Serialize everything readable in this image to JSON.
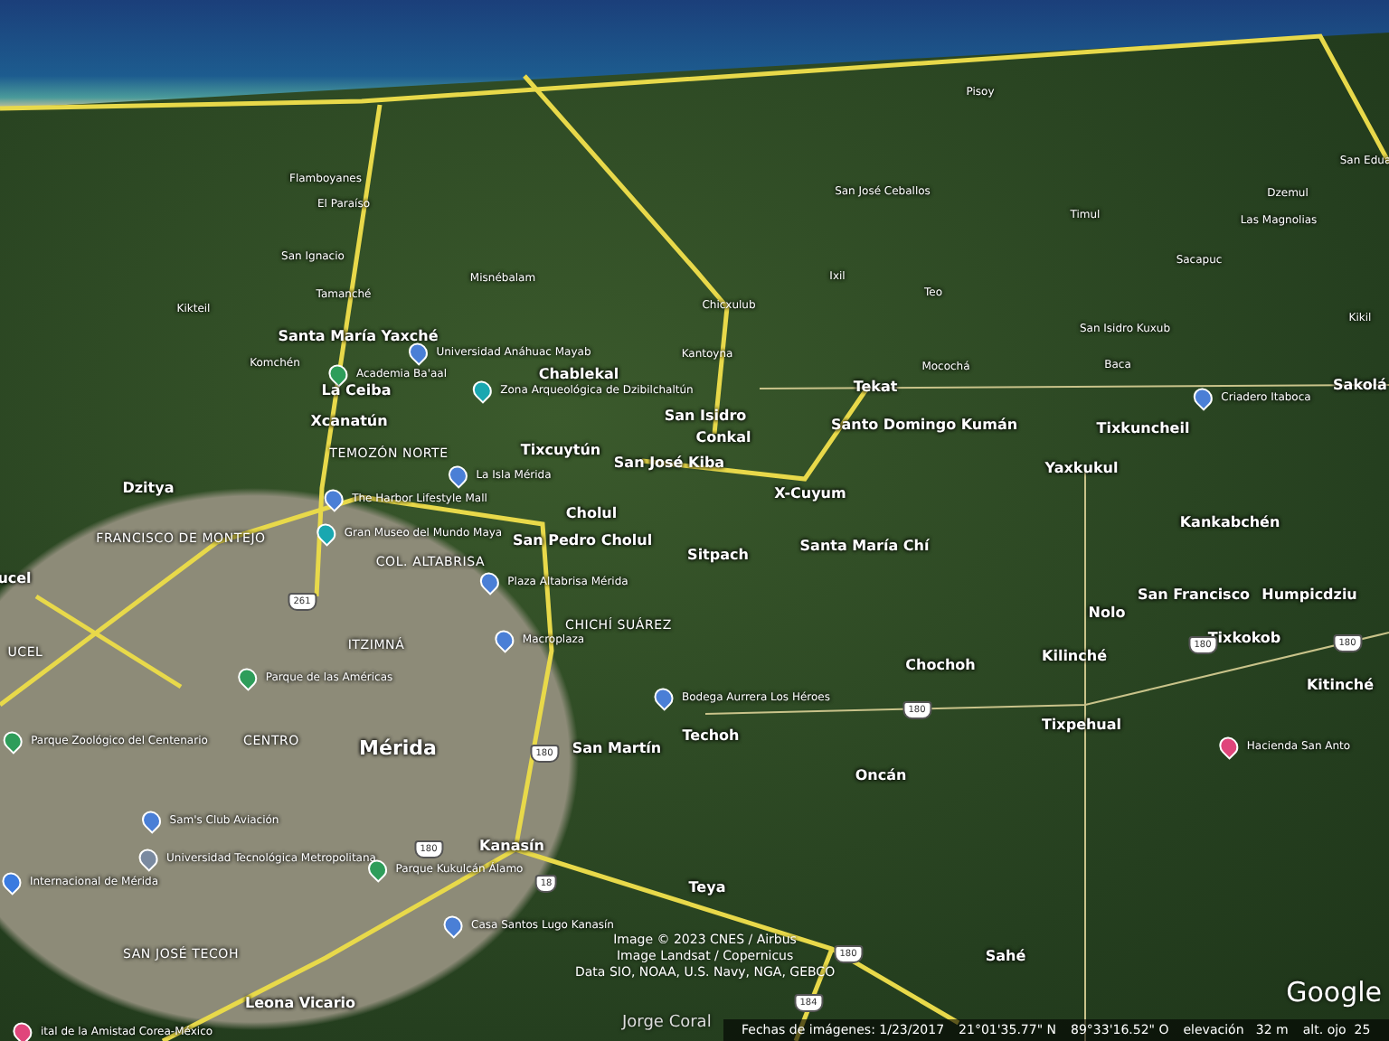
{
  "map": {
    "labels": [
      {
        "text": "Pisoy",
        "kind": "small"
      },
      {
        "text": "San Edua",
        "kind": "small"
      },
      {
        "text": "Flamboyanes",
        "kind": "small"
      },
      {
        "text": "San José Ceballos",
        "kind": "small"
      },
      {
        "text": "Dzemul",
        "kind": "small"
      },
      {
        "text": "El Paraíso",
        "kind": "small"
      },
      {
        "text": "Timul",
        "kind": "small"
      },
      {
        "text": "Las Magnolias",
        "kind": "small"
      },
      {
        "text": "San Ignacio",
        "kind": "small"
      },
      {
        "text": "Sacapuc",
        "kind": "small"
      },
      {
        "text": "Ixil",
        "kind": "small"
      },
      {
        "text": "Misnébalam",
        "kind": "small"
      },
      {
        "text": "Teo",
        "kind": "small"
      },
      {
        "text": "Tamanché",
        "kind": "small"
      },
      {
        "text": "Chicxulub",
        "kind": "small"
      },
      {
        "text": "Kikteil",
        "kind": "small"
      },
      {
        "text": "Kikil",
        "kind": "small"
      },
      {
        "text": "San Isidro Kuxub",
        "kind": "small"
      },
      {
        "text": "Santa María Yaxché",
        "kind": "place"
      },
      {
        "text": "Universidad Anáhuac Mayab",
        "kind": "poi",
        "color": "#4a7fd6"
      },
      {
        "text": "Kantoyna",
        "kind": "small"
      },
      {
        "text": "Komchén",
        "kind": "small"
      },
      {
        "text": "Mocochá",
        "kind": "small"
      },
      {
        "text": "Baca",
        "kind": "small"
      },
      {
        "text": "Academia Ba'aal",
        "kind": "poi",
        "color": "#2e9d5a"
      },
      {
        "text": "Chablekal",
        "kind": "place"
      },
      {
        "text": "Zona Arqueológica de Dzibilchaltún",
        "kind": "poi",
        "color": "#19a7b0"
      },
      {
        "text": "Tekat",
        "kind": "place"
      },
      {
        "text": "Sakolá",
        "kind": "place"
      },
      {
        "text": "Criadero Itaboca",
        "kind": "poi",
        "color": "#4a7fd6"
      },
      {
        "text": "La Ceiba",
        "kind": "place"
      },
      {
        "text": "San Isidro",
        "kind": "place"
      },
      {
        "text": "Xcanatún",
        "kind": "place"
      },
      {
        "text": "Santo Domingo Kumán",
        "kind": "place"
      },
      {
        "text": "Tixkuncheil",
        "kind": "place"
      },
      {
        "text": "Conkal",
        "kind": "place"
      },
      {
        "text": "Tixcuytún",
        "kind": "place"
      },
      {
        "text": "TEMOZÓN NORTE",
        "kind": "district"
      },
      {
        "text": "San José Kiba",
        "kind": "place"
      },
      {
        "text": "Yaxkukul",
        "kind": "place"
      },
      {
        "text": "La Isla Mérida",
        "kind": "poi",
        "color": "#4a7fd6"
      },
      {
        "text": "Dzitya",
        "kind": "place"
      },
      {
        "text": "The Harbor Lifestyle Mall",
        "kind": "poi",
        "color": "#4a7fd6"
      },
      {
        "text": "X-Cuyum",
        "kind": "place"
      },
      {
        "text": "Cholul",
        "kind": "place"
      },
      {
        "text": "Kankabchén",
        "kind": "place"
      },
      {
        "text": "FRANCISCO DE MONTEJO",
        "kind": "district"
      },
      {
        "text": "Gran Museo del Mundo Maya",
        "kind": "poi",
        "color": "#19a7b0"
      },
      {
        "text": "San Pedro Cholul",
        "kind": "place"
      },
      {
        "text": "Santa María Chí",
        "kind": "place"
      },
      {
        "text": "Sitpach",
        "kind": "place"
      },
      {
        "text": "COL. ALTABRISA",
        "kind": "district"
      },
      {
        "text": "ucel",
        "kind": "place"
      },
      {
        "text": "Plaza Altabrisa Mérida",
        "kind": "poi",
        "color": "#4a7fd6"
      },
      {
        "text": "261",
        "kind": "shield"
      },
      {
        "text": "San Francisco",
        "kind": "place"
      },
      {
        "text": "Humpicdziu",
        "kind": "place"
      },
      {
        "text": "Nolo",
        "kind": "place"
      },
      {
        "text": "CHICHÍ SUÁREZ",
        "kind": "district"
      },
      {
        "text": "Macroplaza",
        "kind": "poi",
        "color": "#4a7fd6"
      },
      {
        "text": "Tixkokob",
        "kind": "place"
      },
      {
        "text": "ITZIMNÁ",
        "kind": "district"
      },
      {
        "text": "UCEL",
        "kind": "district"
      },
      {
        "text": "180",
        "kind": "shield"
      },
      {
        "text": "180",
        "kind": "shield"
      },
      {
        "text": "Kilinché",
        "kind": "place"
      },
      {
        "text": "Chochoh",
        "kind": "place"
      },
      {
        "text": "Parque de las Américas",
        "kind": "poi",
        "color": "#2e9d5a"
      },
      {
        "text": "Kitinché",
        "kind": "place"
      },
      {
        "text": "Bodega Aurrera Los Héroes",
        "kind": "poi",
        "color": "#4a7fd6"
      },
      {
        "text": "180",
        "kind": "shield"
      },
      {
        "text": "Tixpehual",
        "kind": "place"
      },
      {
        "text": "Techoh",
        "kind": "place"
      },
      {
        "text": "Parque Zoológico del Centenario",
        "kind": "poi",
        "color": "#2e9d5a"
      },
      {
        "text": "CENTRO",
        "kind": "district"
      },
      {
        "text": "Mérida",
        "kind": "city"
      },
      {
        "text": "San Martín",
        "kind": "place"
      },
      {
        "text": "Hacienda San Anto",
        "kind": "poi",
        "color": "#e0457b"
      },
      {
        "text": "180",
        "kind": "shield"
      },
      {
        "text": "Oncán",
        "kind": "place"
      },
      {
        "text": "Sam's Club Aviación",
        "kind": "poi",
        "color": "#4a7fd6"
      },
      {
        "text": "Kanasín",
        "kind": "place"
      },
      {
        "text": "180",
        "kind": "shield"
      },
      {
        "text": "Universidad Tecnológica Metropolitana",
        "kind": "poi",
        "color": "#7a8aa0"
      },
      {
        "text": "Parque Kukulcán Álamo",
        "kind": "poi",
        "color": "#2e9d5a"
      },
      {
        "text": "Internacional de Mérida",
        "kind": "poi",
        "color": "#3a7be0"
      },
      {
        "text": "18",
        "kind": "shield"
      },
      {
        "text": "Teya",
        "kind": "place"
      },
      {
        "text": "Casa Santos Lugo Kanasín",
        "kind": "poi",
        "color": "#4a7fd6"
      },
      {
        "text": "SAN JOSÉ TECOH",
        "kind": "district"
      },
      {
        "text": "180",
        "kind": "shield"
      },
      {
        "text": "Sahé",
        "kind": "place"
      },
      {
        "text": "184",
        "kind": "shield"
      },
      {
        "text": "Leona Vicario",
        "kind": "place"
      },
      {
        "text": "ital de la Amistad Corea-México",
        "kind": "poi",
        "color": "#e0457b"
      }
    ]
  },
  "credits": [
    "Image © 2023 CNES / Airbus",
    "Image Landsat / Copernicus",
    "Data SIO, NOAA, U.S. Navy, NGA, GEBCO"
  ],
  "author": "Jorge Coral",
  "logo": "Google",
  "status_bar": {
    "imagery_date": "Fechas de imágenes: 1/23/2017",
    "latitude": "21°01'35.77\" N",
    "longitude": "89°33'16.52\" O",
    "elevation": "elevación   32 m",
    "eye_altitude": "alt. ojo  25"
  }
}
